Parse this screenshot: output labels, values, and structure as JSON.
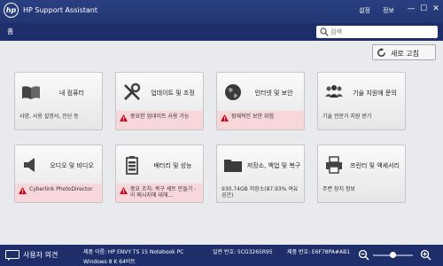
{
  "titlebar": {
    "logo_text": "hp",
    "app_title": "HP Support Assistant",
    "menu": [
      "설정",
      "정보"
    ],
    "controls": {
      "minimize": "—",
      "maximize": "☐",
      "close": "✕"
    }
  },
  "nav": {
    "breadcrumb": "홈",
    "search_placeholder": "검색"
  },
  "refresh_label": "새로 고침",
  "tiles": [
    {
      "title": "내 컴퓨터",
      "status": "사양, 사용 설명서, 진단 등",
      "warn": false,
      "icon": "book-icon"
    },
    {
      "title": "업데이트 및 조정",
      "status": "중요한 업데이트 사용 가능",
      "warn": true,
      "icon": "tools-icon"
    },
    {
      "title": "인터넷 및 보안",
      "status": "잠재적인 보안 위험",
      "warn": true,
      "icon": "globe-icon"
    },
    {
      "title": "기술 지원에 문의",
      "status": "기술 전문가 지원 받기",
      "warn": false,
      "icon": "people-icon"
    },
    {
      "title": "오디오 및 비디오",
      "status": "Cyberlink PhotoDirector",
      "warn": true,
      "icon": "speaker-icon"
    },
    {
      "title": "배터리 및 성능",
      "status": "중요 조치: 복구 세트 만들기 - 이 메시지에 대해...",
      "warn": true,
      "icon": "battery-icon"
    },
    {
      "title": "저장소, 백업 및 복구",
      "status": "930.74GB 저장소(87.93% 여유 공간)",
      "warn": false,
      "icon": "folder-icon"
    },
    {
      "title": "프린터 및 액세서리",
      "status": "주변 장치 정보",
      "warn": false,
      "icon": "printer-icon"
    }
  ],
  "footer": {
    "feedback_label": "사용자 의견",
    "product_name": "제품 이름: HP ENVY TS 15 Notebook PC",
    "os": "Windows 8 K 64비트",
    "serial": "일련 번호: 5CG3265R95",
    "product_number": "제품 번호: E6F78PA#AB1"
  },
  "colors": {
    "titlebar": "#2a3f82",
    "nav": "#1e2e6a",
    "warning_bg": "#f8d7da",
    "warning_icon": "#d0021b"
  }
}
